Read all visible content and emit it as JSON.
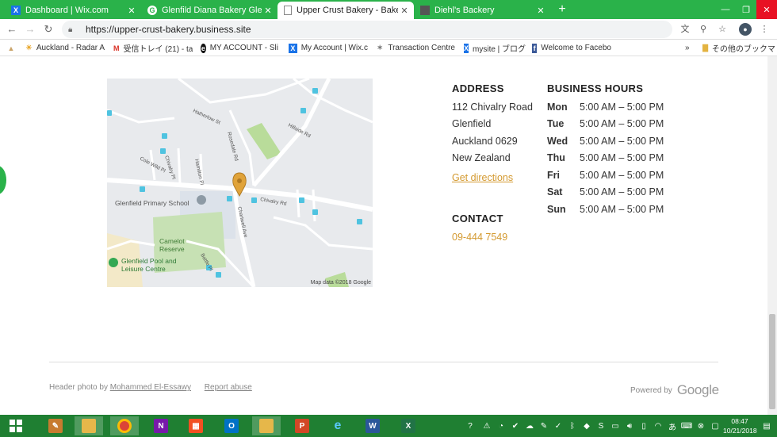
{
  "browser": {
    "tabs": [
      {
        "title": "Dashboard | Wix.com",
        "icon": "wix-icon",
        "active": false
      },
      {
        "title": "Glenfild Diana Bakery Glenfiel",
        "icon": "google-icon",
        "active": false
      },
      {
        "title": "Upper Crust Bakery - Bakery",
        "icon": "page-icon",
        "active": true
      },
      {
        "title": "Diehl's Backery",
        "icon": "cube-icon",
        "active": false
      }
    ],
    "new_tab_symbol": "+",
    "url": "https://upper-crust-bakery.business.site",
    "bookmarks": [
      {
        "label": "Auckland - Radar A",
        "icon": "sun-icon"
      },
      {
        "label": "受信トレイ (21) - tak",
        "icon": "gmail-icon"
      },
      {
        "label": "MY ACCOUNT - Sli",
        "icon": "account-icon"
      },
      {
        "label": "My Account | Wix.c",
        "icon": "wix-icon"
      },
      {
        "label": "Transaction Centre",
        "icon": "star-icon"
      },
      {
        "label": "mysite | ブログ",
        "icon": "wix-icon"
      },
      {
        "label": "Welcome to Facebo",
        "icon": "facebook-icon"
      }
    ],
    "bookmarks_overflow": "»",
    "other_bookmarks": "その他のブックマーク"
  },
  "map": {
    "credit": "Map data ©2018 Google",
    "labels": {
      "hatherlow": "Hatherlow St",
      "hillside": "Hillside Rd",
      "rosedale": "Rosedale Rd",
      "colewild": "Cole Wild Pl",
      "chivalry_pl": "Chivalry Pl",
      "hamilton": "Hamilton Pl",
      "chivalry_rd": "Chivalry Rd",
      "school": "Glenfield Primary School",
      "camelot": "Camelot Reserve",
      "pool": "Glenfield Pool and Leisure Centre",
      "chartwell": "Chartwell Ave",
      "battle": "Battle Pl"
    }
  },
  "address": {
    "heading": "ADDRESS",
    "lines": [
      "112 Chivalry Road",
      "Glenfield",
      "Auckland 0629",
      "New Zealand"
    ],
    "directions": "Get directions"
  },
  "contact": {
    "heading": "CONTACT",
    "phone": "09-444 7549"
  },
  "hours": {
    "heading": "BUSINESS HOURS",
    "rows": [
      {
        "day": "Mon",
        "time": "5:00 AM – 5:00 PM"
      },
      {
        "day": "Tue",
        "time": "5:00 AM – 5:00 PM"
      },
      {
        "day": "Wed",
        "time": "5:00 AM – 5:00 PM"
      },
      {
        "day": "Thu",
        "time": "5:00 AM – 5:00 PM"
      },
      {
        "day": "Fri",
        "time": "5:00 AM – 5:00 PM"
      },
      {
        "day": "Sat",
        "time": "5:00 AM – 5:00 PM"
      },
      {
        "day": "Sun",
        "time": "5:00 AM – 5:00 PM"
      }
    ]
  },
  "footer": {
    "photo_prefix": "Header photo by",
    "photo_author": "Mohammed El-Essawy",
    "report": "Report abuse",
    "powered_by": "Powered by",
    "google": "Google"
  },
  "taskbar": {
    "time": "08:47",
    "date": "10/21/2018"
  },
  "colors": {
    "accent": "#d49a31",
    "chrome": "#2ab24a",
    "taskbar": "#1f7f32"
  }
}
